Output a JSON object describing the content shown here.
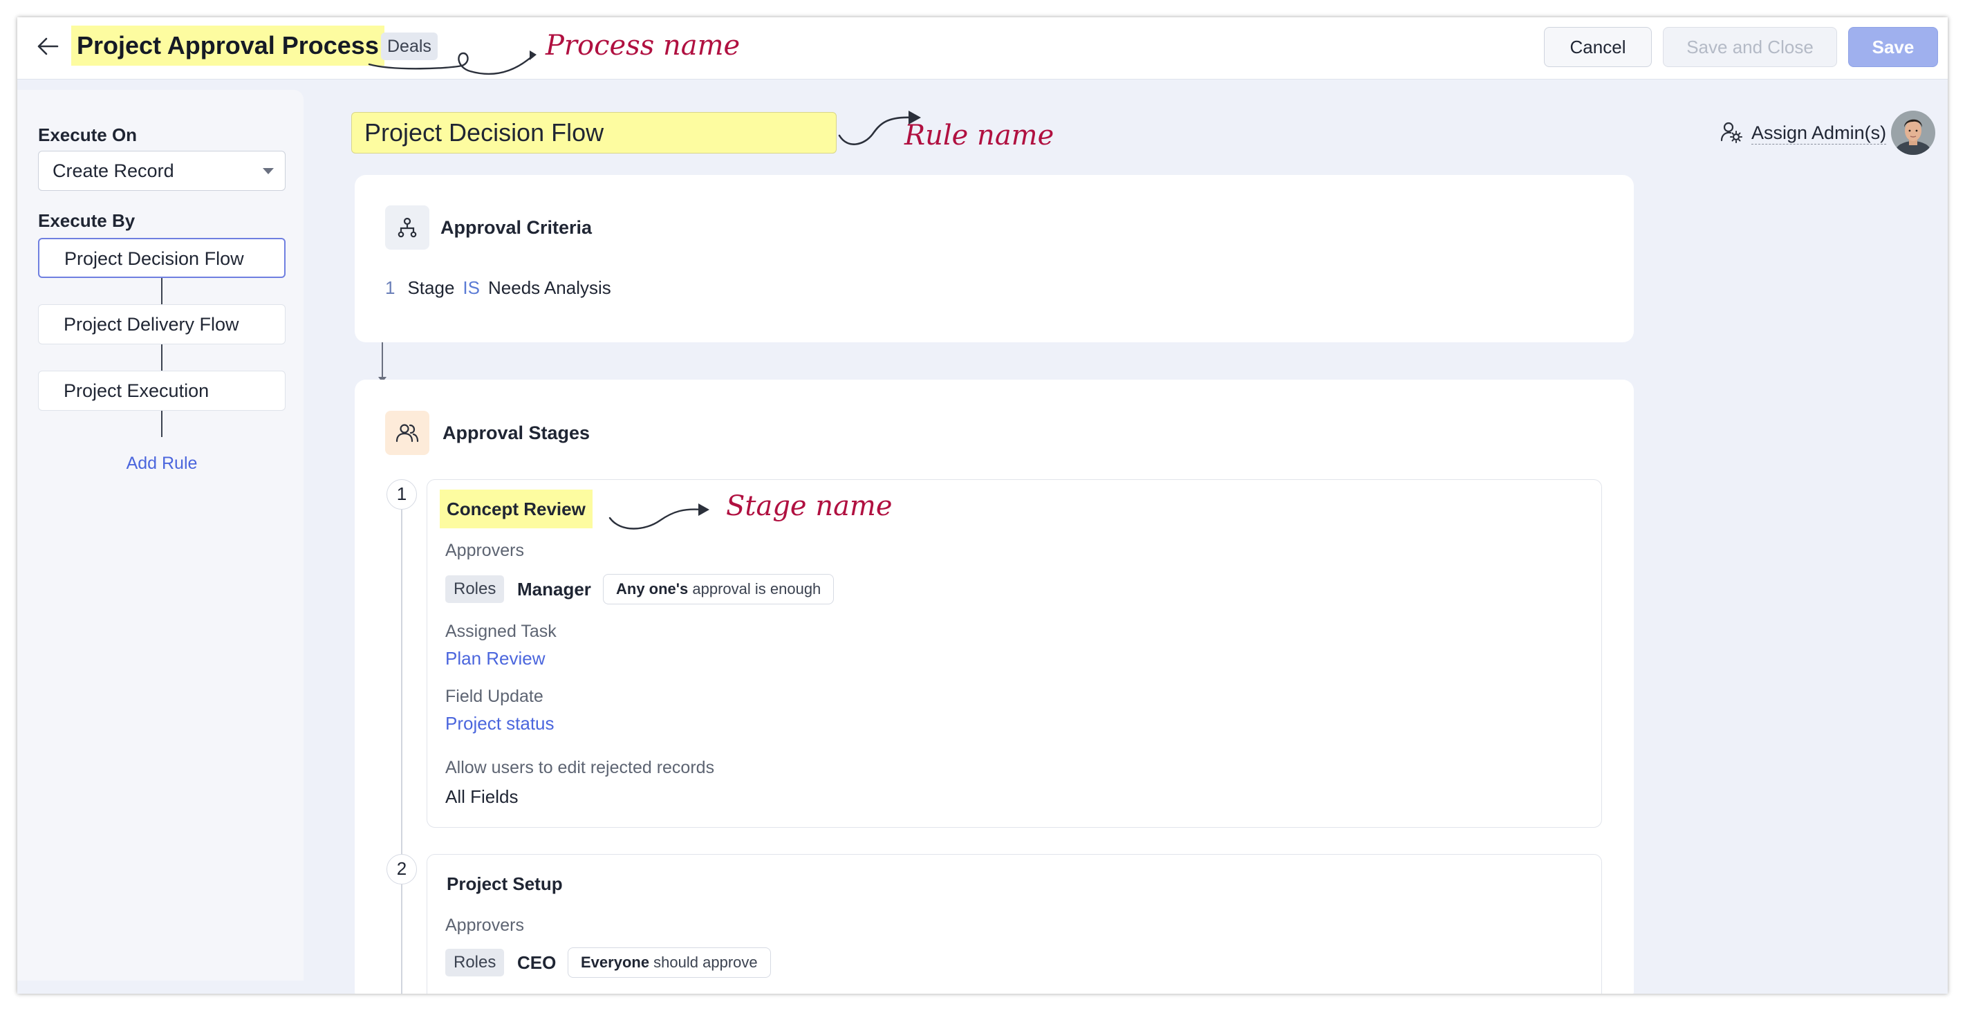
{
  "header": {
    "process_name": "Project Approval Process",
    "module": "Deals",
    "cancel_label": "Cancel",
    "save_close_label": "Save and Close",
    "save_label": "Save"
  },
  "annotations": {
    "process": "Process name",
    "rule": "Rule name",
    "stage": "Stage name"
  },
  "sidebar": {
    "execute_on_label": "Execute On",
    "execute_on_value": "Create Record",
    "execute_by_label": "Execute By",
    "rules": [
      {
        "label": "Project Decision Flow",
        "active": true
      },
      {
        "label": "Project Delivery Flow",
        "active": false
      },
      {
        "label": "Project Execution",
        "active": false
      }
    ],
    "add_rule_label": "Add Rule"
  },
  "main": {
    "rule_name": "Project Decision Flow",
    "assign_admin_label": "Assign Admin(s)",
    "criteria": {
      "title": "Approval Criteria",
      "num": "1",
      "field": "Stage",
      "operator": "IS",
      "value": "Needs Analysis"
    },
    "stages": {
      "title": "Approval Stages",
      "list": [
        {
          "num": "1",
          "name": "Concept Review",
          "approvers_label": "Approvers",
          "roles_chip": "Roles",
          "role": "Manager",
          "approval_bold": "Any one's",
          "approval_rest": " approval is enough",
          "task_label": "Assigned Task",
          "task_value": "Plan Review",
          "field_update_label": "Field Update",
          "field_update_value": "Project status",
          "edit_label": "Allow users to edit rejected records",
          "edit_value": "All Fields"
        },
        {
          "num": "2",
          "name": "Project Setup",
          "approvers_label": "Approvers",
          "roles_chip": "Roles",
          "role": "CEO",
          "approval_bold": "Everyone",
          "approval_rest": " should approve"
        }
      ]
    }
  },
  "colors": {
    "highlight": "#fdfca0",
    "link": "#4b66dd",
    "annotation": "#b01040",
    "save_button": "#9fb0ee"
  },
  "icons": {
    "back": "arrow-left-icon",
    "criteria": "hierarchy-icon",
    "stages": "users-icon",
    "assign_admin": "user-gear-icon",
    "dropdown": "caret-down-icon"
  }
}
